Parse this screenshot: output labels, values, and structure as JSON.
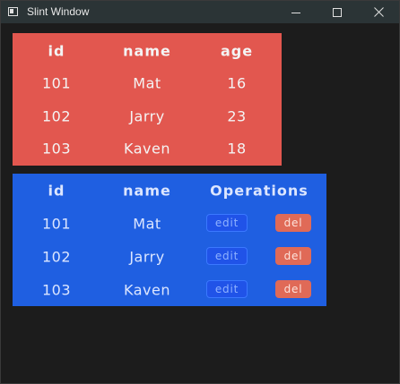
{
  "window": {
    "title": "Slint Window",
    "icons": {
      "app": "app-window-icon",
      "minimize": "minimize-icon",
      "maximize": "maximize-icon",
      "close": "close-icon"
    }
  },
  "colors": {
    "background": "#1c1c1c",
    "titlebar": "#2b3436",
    "red_table": "#e2574f",
    "blue_table": "#1f5fe1",
    "edit_button": "#2053e8",
    "del_button": "#e06a57"
  },
  "red_table": {
    "headers": [
      "id",
      "name",
      "age"
    ],
    "rows": [
      [
        "101",
        "Mat",
        "16"
      ],
      [
        "102",
        "Jarry",
        "23"
      ],
      [
        "103",
        "Kaven",
        "18"
      ]
    ]
  },
  "blue_table": {
    "headers": [
      "id",
      "name",
      "Operations"
    ],
    "rows": [
      [
        "101",
        "Mat"
      ],
      [
        "102",
        "Jarry"
      ],
      [
        "103",
        "Kaven"
      ]
    ],
    "edit_label": "edit",
    "del_label": "del"
  }
}
